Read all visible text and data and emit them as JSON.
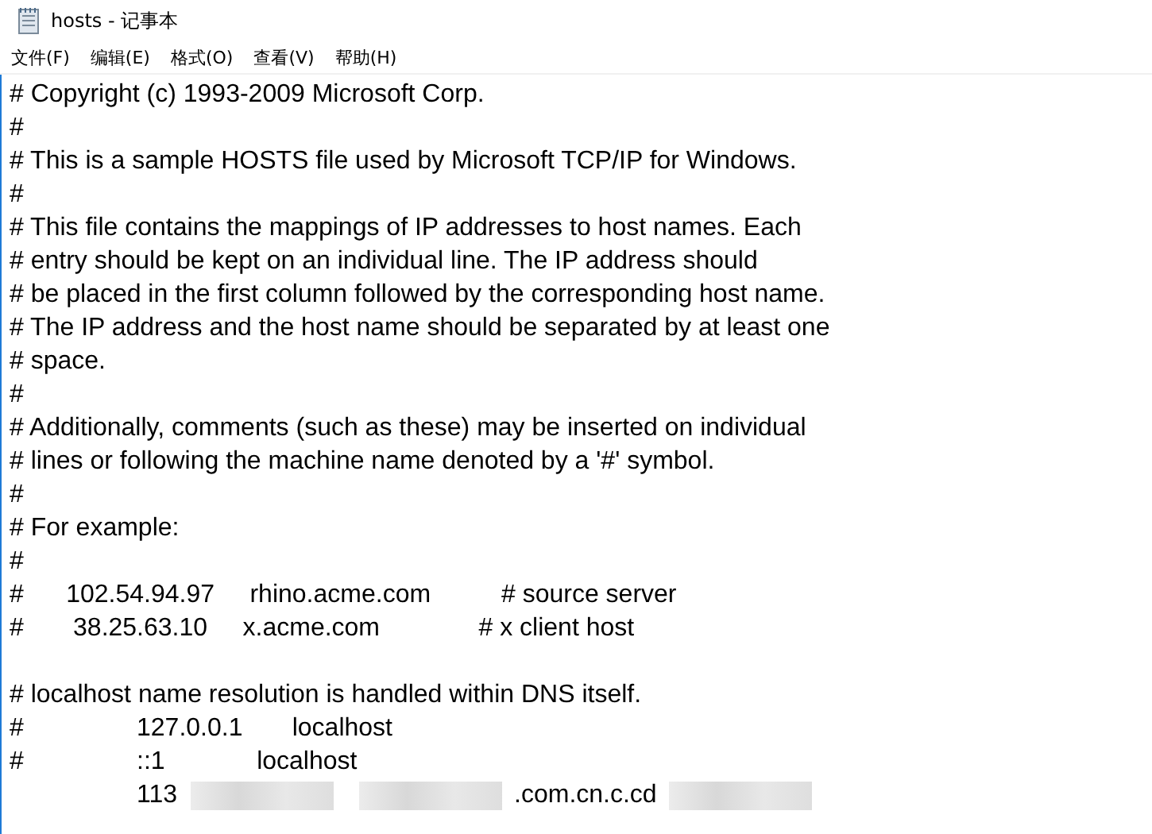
{
  "window": {
    "title": "hosts - 记事本"
  },
  "menu": [
    {
      "label": "文件(F)"
    },
    {
      "label": "编辑(E)"
    },
    {
      "label": "格式(O)"
    },
    {
      "label": "查看(V)"
    },
    {
      "label": "帮助(H)"
    }
  ],
  "lines": [
    [
      {
        "kind": "text",
        "text": "# Copyright (c) 1993-2009 Microsoft Corp."
      }
    ],
    [
      {
        "kind": "text",
        "text": "#"
      }
    ],
    [
      {
        "kind": "text",
        "text": "# This is a sample HOSTS file used by Microsoft TCP/IP for Windows."
      }
    ],
    [
      {
        "kind": "text",
        "text": "#"
      }
    ],
    [
      {
        "kind": "text",
        "text": "# This file contains the mappings of IP addresses to host names. Each"
      }
    ],
    [
      {
        "kind": "text",
        "text": "# entry should be kept on an individual line. The IP address should"
      }
    ],
    [
      {
        "kind": "text",
        "text": "# be placed in the first column followed by the corresponding host name."
      }
    ],
    [
      {
        "kind": "text",
        "text": "# The IP address and the host name should be separated by at least one"
      }
    ],
    [
      {
        "kind": "text",
        "text": "# space."
      }
    ],
    [
      {
        "kind": "text",
        "text": "#"
      }
    ],
    [
      {
        "kind": "text",
        "text": "# Additionally, comments (such as these) may be inserted on individual"
      }
    ],
    [
      {
        "kind": "text",
        "text": "# lines or following the machine name denoted by a '#' symbol."
      }
    ],
    [
      {
        "kind": "text",
        "text": "#"
      }
    ],
    [
      {
        "kind": "text",
        "text": "# For example:"
      }
    ],
    [
      {
        "kind": "text",
        "text": "#"
      }
    ],
    [
      {
        "kind": "text",
        "text": "#      102.54.94.97     rhino.acme.com          # source server"
      }
    ],
    [
      {
        "kind": "text",
        "text": "#       38.25.63.10     x.acme.com              # x client host"
      }
    ],
    [
      {
        "kind": "blank"
      }
    ],
    [
      {
        "kind": "text",
        "text": "# localhost name resolution is handled within DNS itself."
      }
    ],
    [
      {
        "kind": "text",
        "text": "#\t127.0.0.1       localhost"
      }
    ],
    [
      {
        "kind": "text",
        "text": "#\t::1             localhost"
      }
    ],
    [
      {
        "kind": "text",
        "text": "\t113"
      },
      {
        "kind": "redacted"
      },
      {
        "kind": "redacted"
      },
      {
        "kind": "text",
        "text": ".com.cn.c.cd"
      },
      {
        "kind": "redacted"
      }
    ]
  ]
}
